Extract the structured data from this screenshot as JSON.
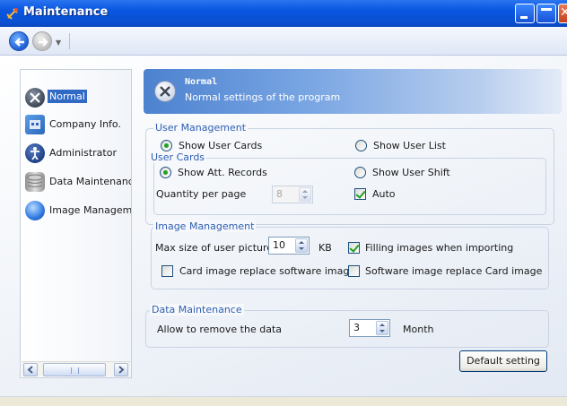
{
  "window": {
    "title": "Maintenance"
  },
  "nav": {
    "items": [
      {
        "label": "Normal",
        "icon": "tools-icon",
        "selected": true
      },
      {
        "label": "Company Info.",
        "icon": "company-icon",
        "selected": false
      },
      {
        "label": "Administrator",
        "icon": "administrator-icon",
        "selected": false
      },
      {
        "label": "Data Maintenance",
        "icon": "database-icon",
        "selected": false
      },
      {
        "label": "Image Management",
        "icon": "image-icon",
        "selected": false
      }
    ]
  },
  "header": {
    "title": "Normal",
    "subtitle": "Normal settings of the program"
  },
  "user_management": {
    "legend": "User Management",
    "show_user_cards": "Show User Cards",
    "show_user_list": "Show User List",
    "selected": "Show User Cards",
    "user_cards": {
      "legend": "User Cards",
      "show_att_records": "Show Att. Records",
      "show_user_shift": "Show User Shift",
      "selected": "Show Att. Records",
      "quantity_label": "Quantity per page",
      "quantity_value": "8",
      "auto_label": "Auto",
      "auto_checked": true
    }
  },
  "image_management": {
    "legend": "Image Management",
    "max_size_label": "Max size of user picture",
    "max_size_value": "10",
    "max_size_unit": "KB",
    "filling_label": "Filling  images when importing",
    "filling_checked": true,
    "card_replace_label": "Card image replace software image",
    "card_replace_checked": false,
    "software_replace_label": "Software image replace Card image",
    "software_replace_checked": false
  },
  "data_maintenance": {
    "legend": "Data Maintenance",
    "remove_label": "Allow to remove the data",
    "remove_value": "3",
    "remove_unit": "Month"
  },
  "buttons": {
    "default_setting": "Default setting"
  },
  "colors": {
    "titlebar": "#0856e0",
    "selection": "#316ac5",
    "legend": "#2f5fb3",
    "check": "#21a121"
  }
}
